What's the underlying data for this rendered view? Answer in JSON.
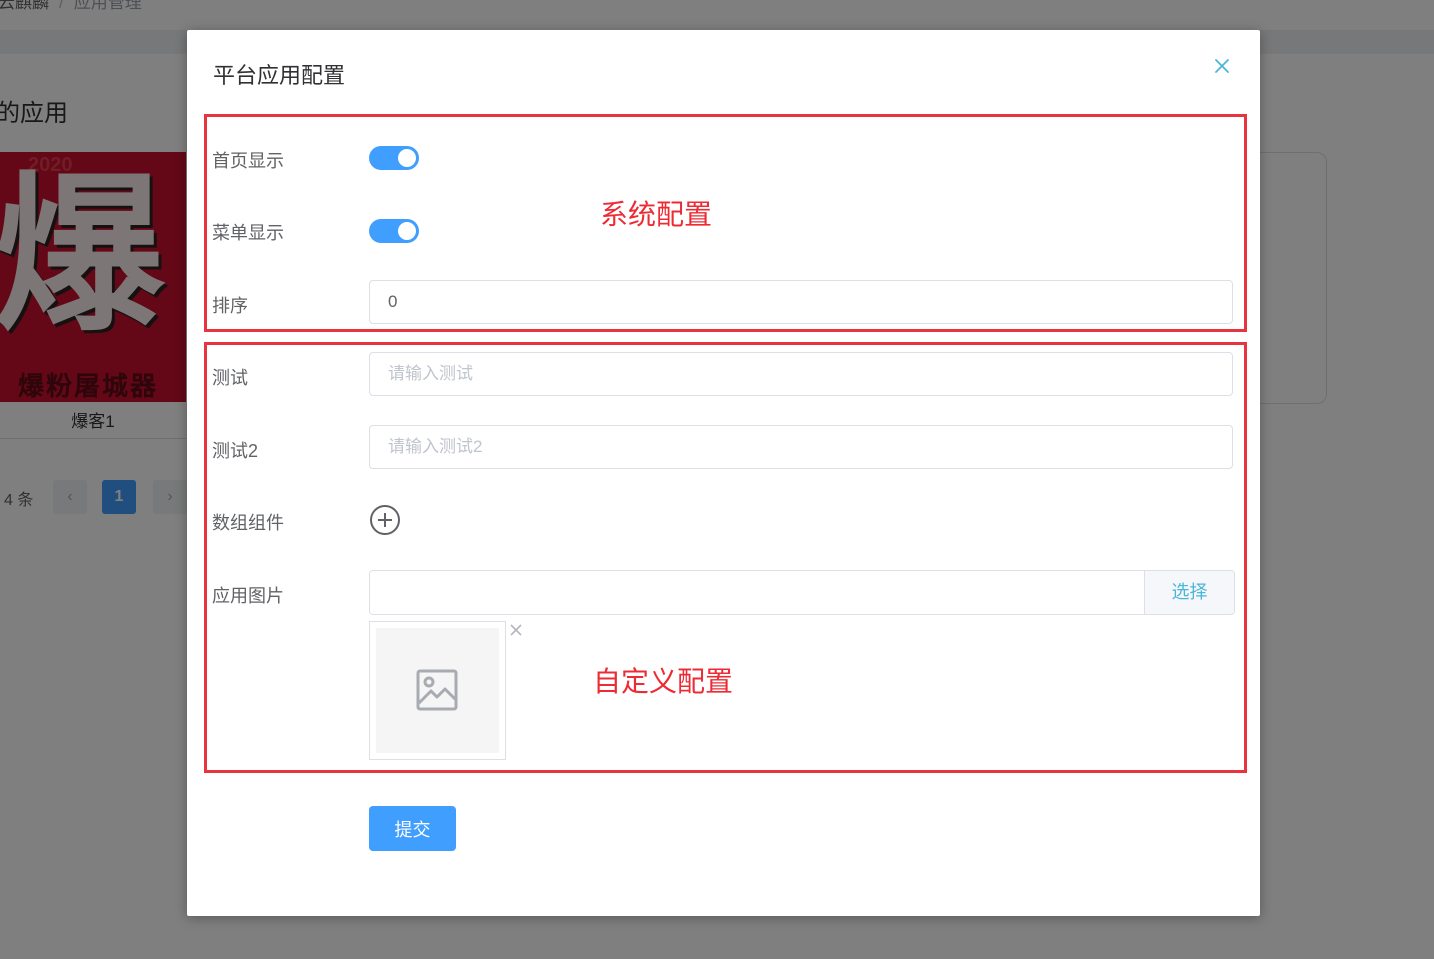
{
  "background": {
    "breadcrumb": [
      "云麒麟",
      "应用管理"
    ],
    "page_title": "的应用",
    "card_label": "爆客1",
    "card_big_char": "爆",
    "card_small_text": "2020",
    "card_bottom_text": "爆粉屠城器",
    "pagination": {
      "total_text": "4 条",
      "prev": "‹",
      "current": "1",
      "next": "›"
    }
  },
  "dialog": {
    "title": "平台应用配置",
    "close_icon": "close-icon",
    "fields": {
      "home_display": {
        "label": "首页显示",
        "checked": true
      },
      "menu_display": {
        "label": "菜单显示",
        "checked": true
      },
      "sort": {
        "label": "排序",
        "value": "0"
      },
      "test": {
        "label": "测试",
        "value": "",
        "placeholder": "请输入测试"
      },
      "test2": {
        "label": "测试2",
        "value": "",
        "placeholder": "请输入测试2"
      },
      "array_component": {
        "label": "数组组件",
        "icon": "plus-circle-icon"
      },
      "app_image": {
        "label": "应用图片",
        "value": "",
        "button": "选择",
        "placeholder_icon": "image-icon",
        "remove_icon": "close-icon"
      }
    },
    "submit_label": "提交"
  },
  "annotations": {
    "system": "系统配置",
    "custom": "自定义配置",
    "color": "#e8343f"
  },
  "colors": {
    "primary": "#409eff",
    "link": "#4ab6d8"
  }
}
